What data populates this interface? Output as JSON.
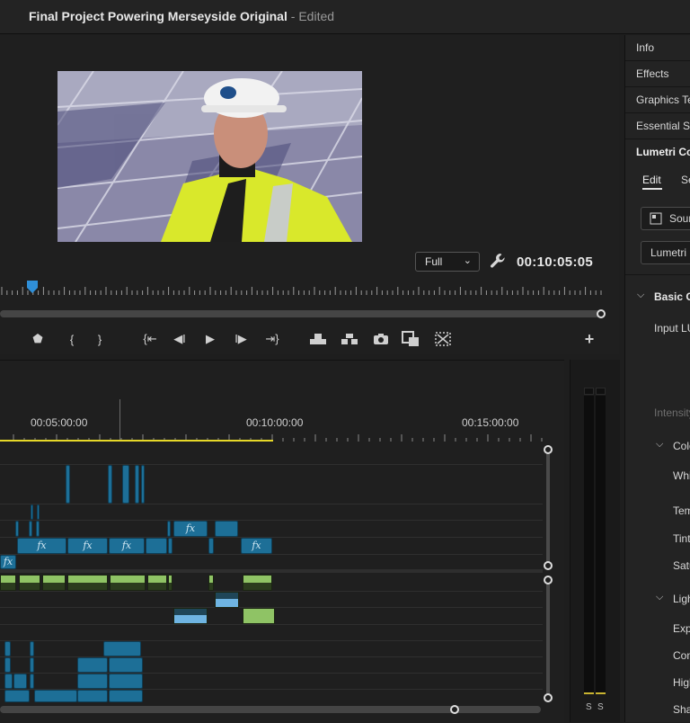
{
  "window": {
    "title": "Final Project Powering Merseyside Original",
    "separator": " - ",
    "status": "Edited"
  },
  "program_monitor": {
    "resolution": "Full",
    "timecode": "00:10:05:05",
    "toolbar": [
      {
        "name": "add-marker-icon",
        "glyph": "⬟"
      },
      {
        "name": "mark-in-icon",
        "glyph": "{"
      },
      {
        "name": "mark-out-icon",
        "glyph": "}"
      },
      {
        "name": "go-to-in-icon",
        "glyph": "{⇤"
      },
      {
        "name": "step-back-icon",
        "glyph": "◀I"
      },
      {
        "name": "play-icon",
        "glyph": "▶"
      },
      {
        "name": "step-forward-icon",
        "glyph": "I▶"
      },
      {
        "name": "go-to-out-icon",
        "glyph": "⇥}"
      },
      {
        "name": "lift-icon",
        "glyph": "⏏"
      },
      {
        "name": "extract-icon",
        "glyph": "⏏"
      },
      {
        "name": "export-frame-icon",
        "glyph": "📷"
      },
      {
        "name": "comparison-view-icon",
        "glyph": "◧"
      },
      {
        "name": "vr-video-icon",
        "glyph": "⊠"
      },
      {
        "name": "add-button-icon",
        "glyph": "+"
      }
    ]
  },
  "right_panel": {
    "tabs": [
      "Info",
      "Effects",
      "Graphics Templates",
      "Essential Sound",
      "Lumetri Color"
    ],
    "lumetri": {
      "subtabs": [
        "Edit",
        "Settings"
      ],
      "source_label": "Source",
      "preset_label": "Lumetri Color",
      "section": "Basic Correction",
      "input_lut": "Input LUT",
      "intensity": "Intensity",
      "color_section": "Color",
      "white_balance": "White Balance",
      "temperature": "Temperature",
      "tint": "Tint",
      "saturation": "Saturation",
      "light_section": "Light",
      "exposure": "Exposure",
      "contrast": "Contrast",
      "highlights": "Highlights",
      "shadows": "Shadows"
    }
  },
  "timeline": {
    "timecodes": [
      "00:05:00:00",
      "00:10:00:00",
      "00:15:00:00"
    ],
    "fx_label": "fx"
  },
  "audio_meter": {
    "channel_labels": [
      "S",
      "S"
    ]
  },
  "colors": {
    "accent_blue": "#2f8fd8",
    "clip_blue": "#1d6f97",
    "audio_green": "#8fc365",
    "work_area": "#e6d728"
  }
}
